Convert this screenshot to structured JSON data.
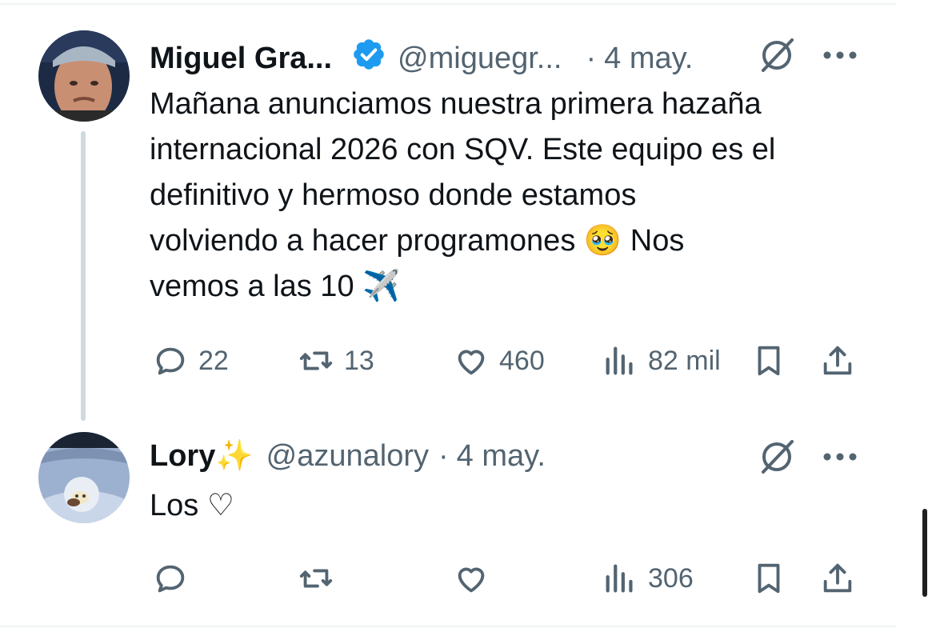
{
  "tweets": [
    {
      "author": {
        "name": "Miguel Gra...",
        "handle": "@miguegr...",
        "verified": true
      },
      "date": "4 may.",
      "separator": "·",
      "text": [
        "Mañana anunciamos nuestra primera hazaña",
        "internacional 2026 con SQV. Este equipo es el",
        "definitivo y hermoso donde estamos",
        "volviendo a hacer programones 🥹 Nos",
        "vemos a las 10 ✈️"
      ],
      "actions": {
        "replies": "22",
        "retweets": "13",
        "likes": "460",
        "views": "82 mil"
      }
    },
    {
      "author": {
        "name": "Lory✨",
        "handle": "@azunalory",
        "verified": false
      },
      "date": "4 may.",
      "separator": "·",
      "text": [
        "Los ♡"
      ],
      "actions": {
        "replies": "",
        "retweets": "",
        "likes": "",
        "views": "306"
      }
    }
  ],
  "colors": {
    "verified_badge": "#1d9bf0",
    "secondary_text": "#536471",
    "thread_line": "#cfd9de"
  },
  "icons": [
    "comment-icon",
    "retweet-icon",
    "heart-icon",
    "views-icon",
    "bookmark-icon",
    "share-icon",
    "grok-icon",
    "more-icon",
    "verified-icon"
  ]
}
